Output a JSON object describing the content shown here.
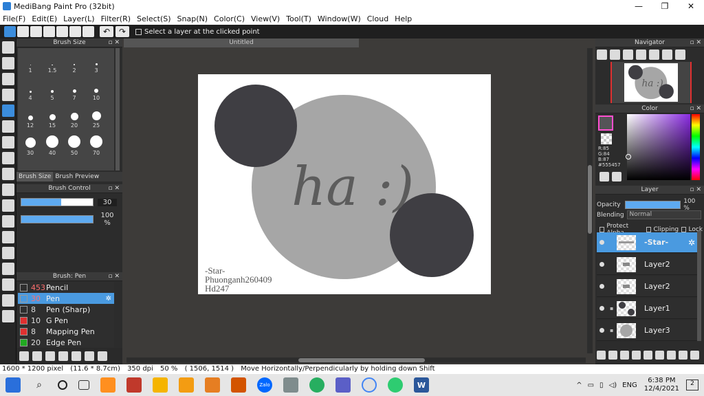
{
  "window": {
    "title": "MediBang Paint Pro (32bit)",
    "controls": [
      "—",
      "❐",
      "✕"
    ]
  },
  "menu": [
    "File(F)",
    "Edit(E)",
    "Layer(L)",
    "Filter(R)",
    "Select(S)",
    "Snap(N)",
    "Color(C)",
    "View(V)",
    "Tool(T)",
    "Window(W)",
    "Cloud",
    "Help"
  ],
  "toolbar": {
    "select_layer_label": "Select a layer at the clicked point",
    "undo_glyph": "↶",
    "redo_glyph": "↷"
  },
  "brush_size": {
    "title": "Brush Size",
    "sizes": [
      "1",
      "1.5",
      "2",
      "3",
      "4",
      "5",
      "7",
      "10",
      "12",
      "15",
      "20",
      "25",
      "30",
      "40",
      "50",
      "70"
    ],
    "tabs": [
      "Brush Size",
      "Brush Preview"
    ]
  },
  "brush_control": {
    "title": "Brush Control",
    "size_value": "30",
    "size_fraction": 0.56,
    "opacity_value": "100 %",
    "opacity_fraction": 1.0
  },
  "brush_list": {
    "title": "Brush: Pen",
    "items": [
      {
        "num": "453",
        "name": "Pencil",
        "color": "#2e2e2e",
        "num_red": true
      },
      {
        "num": "30",
        "name": "Pen",
        "color": "#4a9ae0",
        "num_red": true,
        "selected": true
      },
      {
        "num": "8",
        "name": "Pen (Sharp)",
        "color": "#2e2e2e"
      },
      {
        "num": "10",
        "name": "G Pen",
        "color": "#e03030"
      },
      {
        "num": "8",
        "name": "Mapping Pen",
        "color": "#e03030"
      },
      {
        "num": "20",
        "name": "Edge Pen",
        "color": "#22aa22"
      }
    ],
    "gear_glyph": "✲"
  },
  "canvas": {
    "tab": "Untitled",
    "text": "ha :)",
    "credits": [
      "-Star-",
      "Phuonganh260409",
      "Hd247"
    ],
    "colors": {
      "dark_circle": "#3f3e43",
      "light_circle": "#a6a6a6",
      "text": "#5c5c5c"
    }
  },
  "navigator": {
    "title": "Navigator"
  },
  "color": {
    "title": "Color",
    "r": "R:85",
    "g": "G:84",
    "b": "B:87",
    "hex": "#555457"
  },
  "layer": {
    "title": "Layer",
    "opacity_label": "Opacity",
    "opacity_value": "100 %",
    "blending_label": "Blending",
    "blending_value": "Normal",
    "protect_alpha": "Protect Alpha",
    "clipping": "Clipping",
    "lock": "Lock",
    "layers": [
      {
        "name": "-Star-",
        "selected": true
      },
      {
        "name": "Layer2"
      },
      {
        "name": "Layer2"
      },
      {
        "name": "Layer1"
      },
      {
        "name": "Layer3"
      }
    ],
    "gear_glyph": "✲",
    "lock_glyph": "🔒"
  },
  "status": {
    "size": "1600 * 1200 pixel",
    "physical": "(11.6 * 8.7cm)",
    "dpi": "350 dpi",
    "zoom": "50 %",
    "coords": "( 1506, 1514 )",
    "hint": "Move Horizontally/Perpendicularly by holding down Shift"
  },
  "taskbar": {
    "lang": "ENG",
    "time": "6:38 PM",
    "date": "12/4/2021",
    "notifications": "2",
    "zalo_label": "Zalo",
    "word_label": "W",
    "search_glyph": "⌕"
  }
}
